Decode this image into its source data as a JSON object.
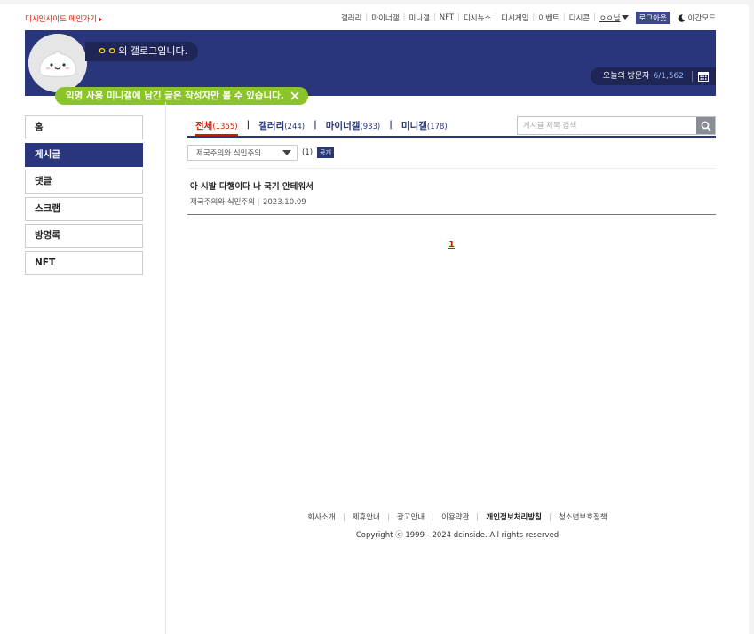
{
  "topbar": {
    "main_link": "디시인사이드 메인가기",
    "nav": [
      "갤러리",
      "마이너갤",
      "미니갤",
      "NFT",
      "디시뉴스",
      "디시게임",
      "이벤트",
      "디시콘"
    ],
    "user": "ㅇㅇ님",
    "logout": "로그아웃",
    "night_mode": "야간모드"
  },
  "banner": {
    "owner_dots": "ㅇㅇ",
    "title_suffix": "의 갤로그입니다.",
    "visitor_label": "오늘의 방문자",
    "visitor_count": "6/1,562",
    "notice": "익명 사용 미니갤에 남긴 글은 작성자만 볼 수 있습니다."
  },
  "sidebar": {
    "items": [
      {
        "label": "홈"
      },
      {
        "label": "게시글"
      },
      {
        "label": "댓글"
      },
      {
        "label": "스크랩"
      },
      {
        "label": "방명록"
      },
      {
        "label": "NFT"
      }
    ]
  },
  "tabs": [
    {
      "label": "전체",
      "count": "(1355)"
    },
    {
      "label": "갤러리",
      "count": "(244)"
    },
    {
      "label": "마이너갤",
      "count": "(933)"
    },
    {
      "label": "미니갤",
      "count": "(178)"
    }
  ],
  "search": {
    "placeholder": "게시글 제목 검색"
  },
  "filter": {
    "selected": "제국주의와 식민주의",
    "count": "(1)",
    "badge": "공개"
  },
  "posts": [
    {
      "title": "아 시발 다행이다 나 국기 안테워서",
      "gallery": "제국주의와 식민주의",
      "date": "2023.10.09"
    }
  ],
  "pagination": {
    "current": "1"
  },
  "footer": {
    "links": [
      "회사소개",
      "제휴안내",
      "광고안내",
      "이용약관",
      "개인정보처리방침",
      "청소년보호정책"
    ],
    "copyright_prefix": "Copyright",
    "copyright_symbol": "ⓒ",
    "copyright_text": "1999 - 2024 dcinside. All rights reserved"
  },
  "colors": {
    "brand_navy": "#29367c",
    "dark_pill": "#1f2554",
    "accent_red": "#d31900",
    "notice_green": "#8bc42a",
    "dot_yellow": "#ffd400"
  },
  "icons": [
    "moon-icon",
    "calendar-icon",
    "close-icon",
    "search-icon",
    "dumpling-avatar-icon",
    "dropdown-triangle-icon",
    "right-arrow-icon"
  ]
}
